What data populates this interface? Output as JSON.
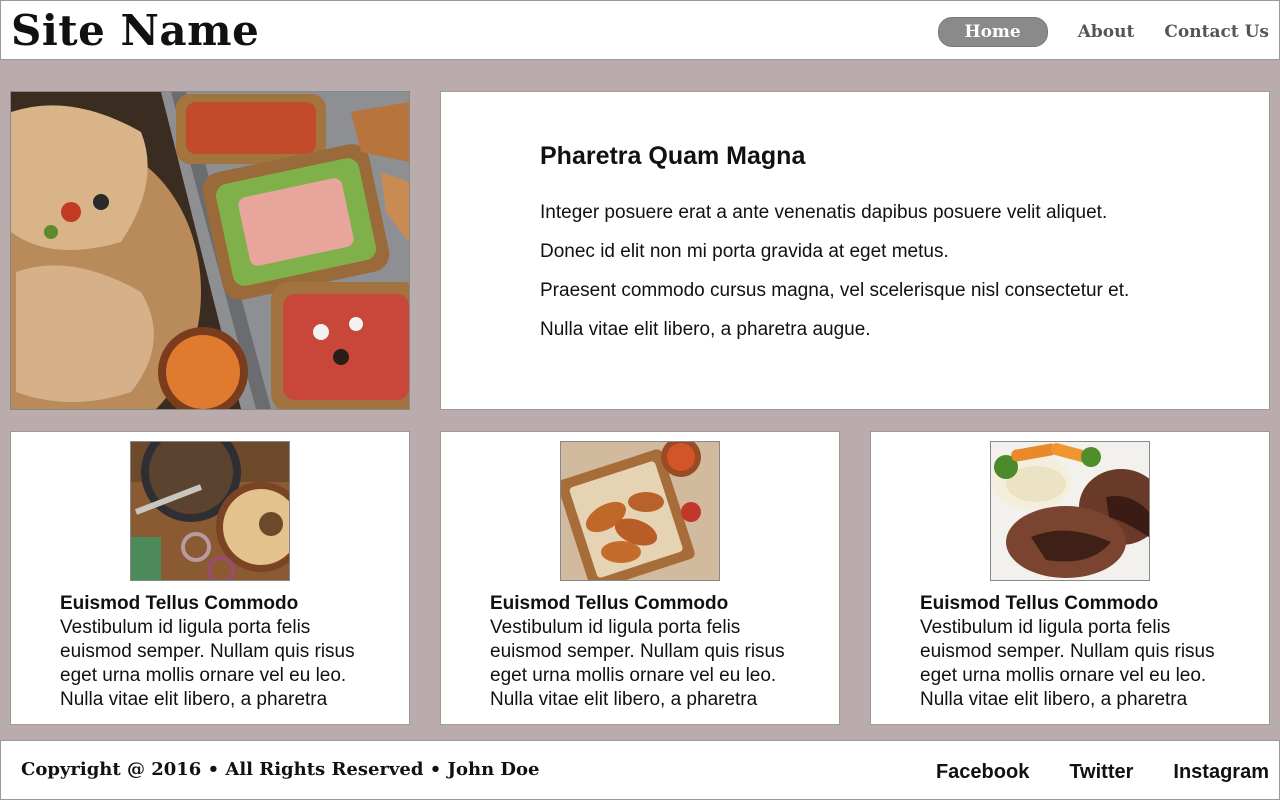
{
  "header": {
    "site_name": "Site Name",
    "nav": [
      {
        "label": "Home",
        "active": true
      },
      {
        "label": "About",
        "active": false
      },
      {
        "label": "Contact Us",
        "active": false
      }
    ]
  },
  "hero": {
    "image": "food-platter-image",
    "title": "Pharetra Quam Magna",
    "lines": [
      "Integer posuere erat a ante venenatis dapibus posuere velit aliquet.",
      "Donec id elit non mi porta gravida at eget metus.",
      "Praesent commodo cursus magna, vel scelerisque nisl consectetur et.",
      "Nulla vitae elit libero, a pharetra augue."
    ]
  },
  "cards": [
    {
      "image": "hummus-bowl-image",
      "title": "Euismod Tellus Commodo",
      "lines": [
        "Vestibulum id ligula porta felis",
        "euismod semper. Nullam quis risus",
        "eget urna mollis ornare vel eu leo.",
        "Nulla vitae elit libero, a pharetra"
      ]
    },
    {
      "image": "chicken-wings-image",
      "title": "Euismod Tellus Commodo",
      "lines": [
        "Vestibulum id ligula porta felis",
        "euismod semper. Nullam quis risus",
        "eget urna mollis ornare vel eu leo.",
        "Nulla vitae elit libero, a pharetra"
      ]
    },
    {
      "image": "steak-plate-image",
      "title": "Euismod Tellus Commodo",
      "lines": [
        "Vestibulum id ligula porta felis",
        "euismod semper. Nullam quis risus",
        "eget urna mollis ornare vel eu leo.",
        "Nulla vitae elit libero, a pharetra"
      ]
    }
  ],
  "footer": {
    "copyright": "Copyright @ 2016 • All Rights Reserved • John Doe",
    "social": [
      "Facebook",
      "Twitter",
      "Instagram"
    ]
  }
}
